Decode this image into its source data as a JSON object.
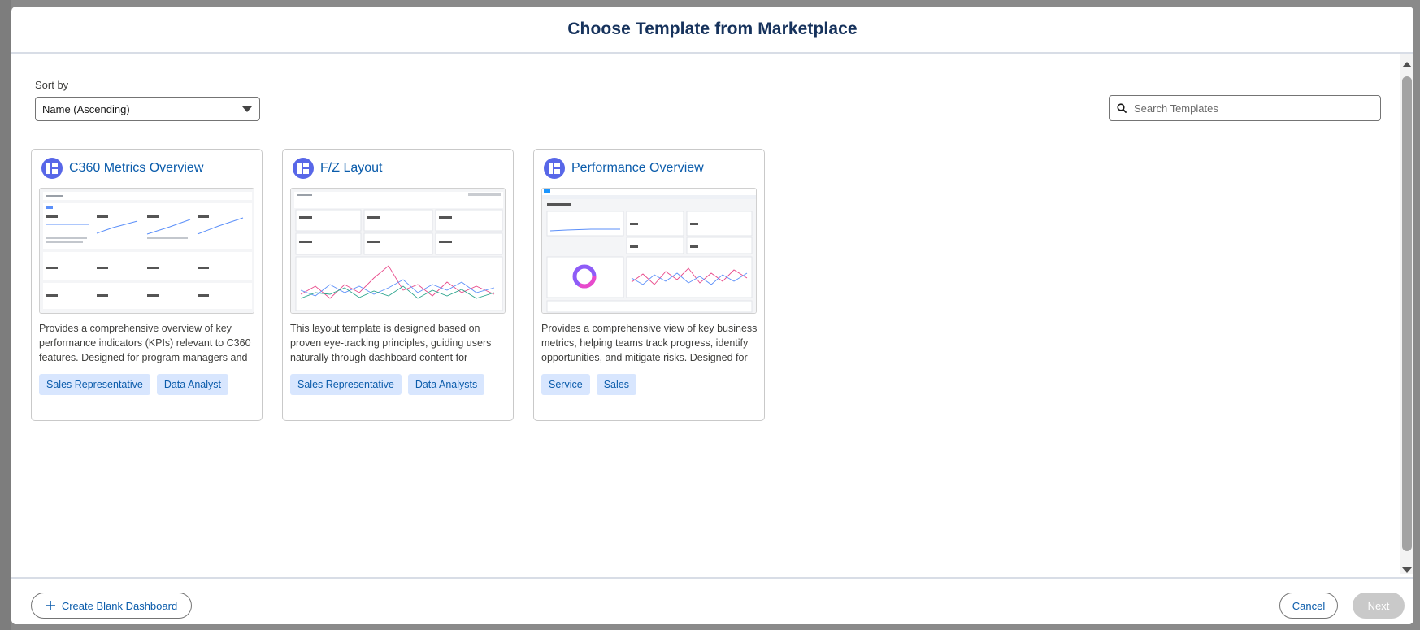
{
  "modal": {
    "title": "Choose Template from Marketplace"
  },
  "sort": {
    "label": "Sort by",
    "selected": "Name (Ascending)"
  },
  "search": {
    "placeholder": "Search Templates",
    "value": ""
  },
  "cards": [
    {
      "title": "C360 Metrics Overview",
      "description": "Provides a comprehensive overview of key performance indicators (KPIs) relevant to C360 features. Designed for program managers and stakeh…",
      "tags": [
        "Sales Representative",
        "Data Analyst"
      ]
    },
    {
      "title": "F/Z Layout",
      "description": "This layout template is designed based on proven eye-tracking principles, guiding users naturally through dashboard content for maximized com…",
      "tags": [
        "Sales Representative",
        "Data Analysts"
      ]
    },
    {
      "title": "Performance Overview",
      "description": "Provides a comprehensive view of key business metrics, helping teams track progress, identify opportunities, and mitigate risks. Designed for sal…",
      "tags": [
        "Service",
        "Sales"
      ]
    }
  ],
  "footer": {
    "create_label": "Create Blank Dashboard",
    "cancel_label": "Cancel",
    "next_label": "Next"
  },
  "icons": {
    "template_logo": "dashboard-template-icon",
    "search": "search-icon",
    "plus": "plus-icon"
  },
  "colors": {
    "accent": "#0b5cab",
    "logo": "#5867e8",
    "tag_bg": "#d8e6fe",
    "title": "#16325c"
  }
}
